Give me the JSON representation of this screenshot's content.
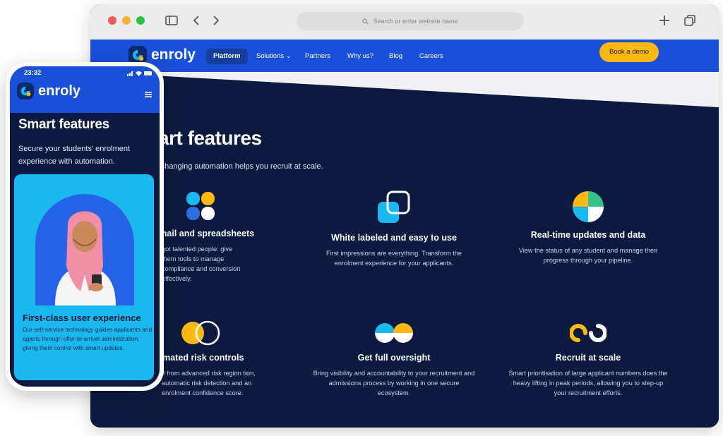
{
  "browser": {
    "url_placeholder": "Search or enter website name"
  },
  "site": {
    "brand": "enroly",
    "nav": [
      {
        "label": "Platform"
      },
      {
        "label": "Solutions ⌄"
      },
      {
        "label": "Partners"
      },
      {
        "label": "Why us?"
      },
      {
        "label": "Blog"
      },
      {
        "label": "Careers"
      }
    ],
    "cta": "Book a demo"
  },
  "page": {
    "heading": "art features",
    "subheading": "-changing automation helps you recruit at scale."
  },
  "features": [
    {
      "icon": "clover-icon",
      "title": "e email and spreadsheets",
      "desc": "got talented people: give them tools to manage compliance and conversion effectively."
    },
    {
      "icon": "overlap-squares-icon",
      "title": "White labeled and easy to use",
      "desc": "First impressions are everything. Transform the enrolment experience for your applicants."
    },
    {
      "icon": "quadrant-circle-icon",
      "title": "Real-time updates and data",
      "desc": "View the status of any student and manage their progress through your pipeline."
    },
    {
      "icon": "double-circle-icon",
      "title": "omated risk controls",
      "desc": "lt from advanced risk region tion, automatic risk detection and an enrolment confidence score."
    },
    {
      "icon": "half-circles-icon",
      "title": "Get full oversight",
      "desc": "Bring visibility and accountability to your recruitment and admissions process by working in one secure ecosystem."
    },
    {
      "icon": "link-rings-icon",
      "title": "Recruit at scale",
      "desc": "Smart prioritisation of large applicant numbers does the heavy lifting in peak periods, allowing you to step-up your recruitment efforts."
    }
  ],
  "phone": {
    "time": "23:32",
    "brand": "enroly",
    "title": "Smart features",
    "subtitle": "Secure your students' enrolment experience with automation.",
    "card_title": "First-class user experience",
    "card_desc": "Our self-service technology guides applicants and agents through offer-to-arrival administration, giving them control with smart updates."
  },
  "colors": {
    "nav_blue": "#1a4fd8",
    "dark_navy": "#0c1a3f",
    "accent_yellow": "#fcb813",
    "accent_cyan": "#1ab8ee"
  }
}
